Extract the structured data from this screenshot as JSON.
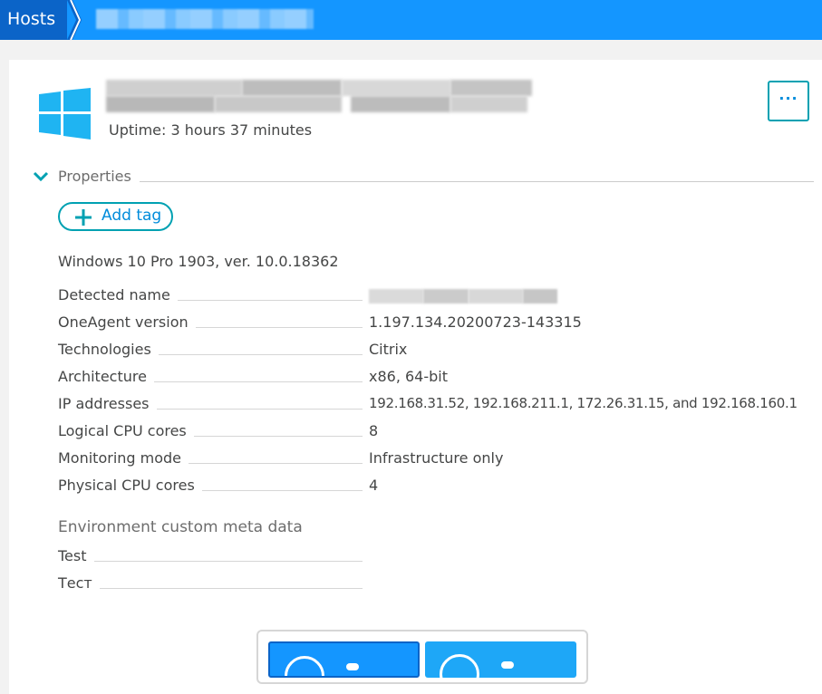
{
  "breadcrumb": {
    "root_label": "Hosts"
  },
  "host": {
    "os_icon": "windows-logo-icon",
    "uptime": "Uptime: 3 hours 37 minutes",
    "more_label": "···"
  },
  "properties": {
    "section_label": "Properties",
    "add_tag_label": "Add tag",
    "os_description": "Windows 10 Pro 1903, ver. 10.0.18362",
    "rows": [
      {
        "key": "Detected name",
        "value": ""
      },
      {
        "key": "OneAgent version",
        "value": "1.197.134.20200723-143315"
      },
      {
        "key": "Technologies",
        "value": "Citrix"
      },
      {
        "key": "Architecture",
        "value": "x86, 64-bit"
      },
      {
        "key": "IP addresses",
        "value": "192.168.31.52, 192.168.211.1, 172.26.31.15, and 192.168.160.1"
      },
      {
        "key": "Logical CPU cores",
        "value": "8"
      },
      {
        "key": "Monitoring mode",
        "value": "Infrastructure only"
      },
      {
        "key": "Physical CPU cores",
        "value": "4"
      }
    ]
  },
  "custom_meta": {
    "title": "Environment custom meta data",
    "rows": [
      {
        "key": "Test",
        "value": ""
      },
      {
        "key": "Тест",
        "value": ""
      }
    ]
  },
  "colors": {
    "topbar": "#1496ff",
    "breadcrumb_root": "#0b64c8",
    "accent_teal": "#00a1b2",
    "windows_blue": "#1fb4f2"
  }
}
